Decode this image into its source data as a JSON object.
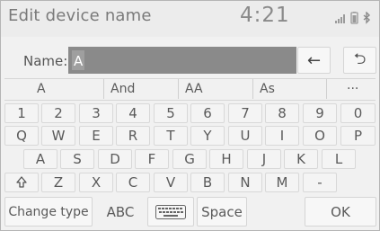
{
  "header": {
    "title": "Edit device name",
    "clock": "4:21",
    "icons": [
      "signal-icon",
      "battery-icon",
      "bluetooth-icon"
    ]
  },
  "name_field": {
    "label": "Name:",
    "value": "A"
  },
  "controls": {
    "backspace_icon": "←",
    "return_icon": "⮌"
  },
  "suggestions": [
    "A",
    "And",
    "AA",
    "As",
    "···"
  ],
  "keys": {
    "row1": [
      "1",
      "2",
      "3",
      "4",
      "5",
      "6",
      "7",
      "8",
      "9",
      "0"
    ],
    "row2": [
      "Q",
      "W",
      "E",
      "R",
      "T",
      "Y",
      "U",
      "I",
      "O",
      "P"
    ],
    "row3": [
      "A",
      "S",
      "D",
      "F",
      "G",
      "H",
      "J",
      "K",
      "L"
    ],
    "row4": [
      "Z",
      "X",
      "C",
      "V",
      "B",
      "N",
      "M",
      "-"
    ]
  },
  "bottom": {
    "change_type": "Change type",
    "abc": "ABC",
    "space": "Space",
    "ok": "OK"
  },
  "colors": {
    "input_bg": "#8a8a8a",
    "key_bg": "#f4f4f4",
    "screen_bg": "#f1f1f1"
  }
}
